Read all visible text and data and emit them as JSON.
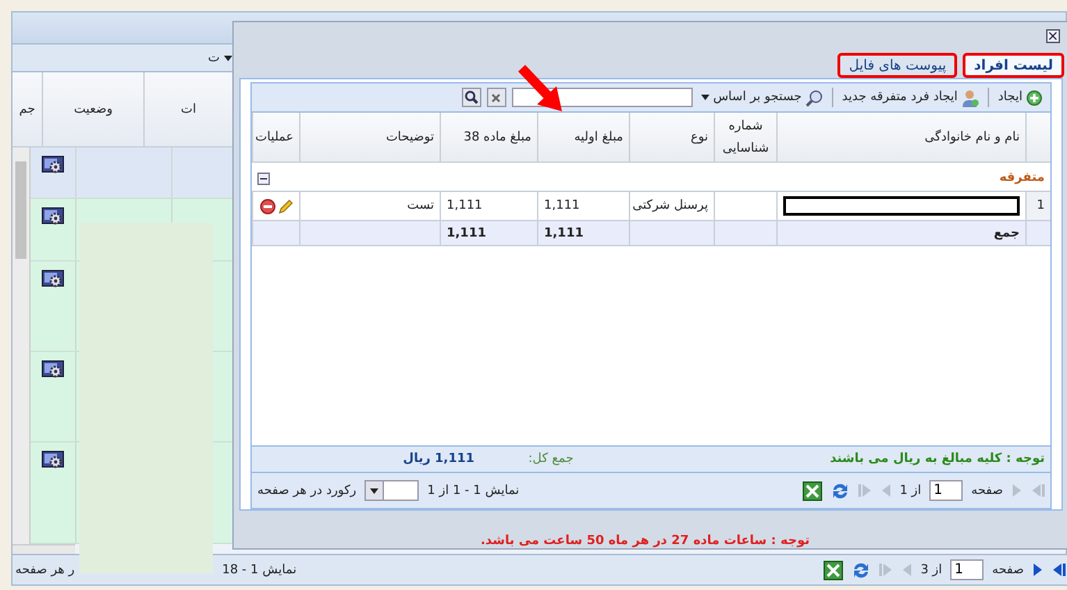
{
  "background_grid": {
    "toolbar_label": "ت",
    "columns": [
      "ات",
      "وضعیت",
      "جم"
    ],
    "rows": [
      {
        "selected": true
      },
      {
        "selected": false
      },
      {
        "selected": false
      },
      {
        "selected": false
      },
      {
        "selected": false
      }
    ],
    "pager": {
      "per_page_label": "ر هر صفحه",
      "summary": "نمایش 1 - 18",
      "page_label": "صفحه",
      "page": "1",
      "of": "از 3",
      "prev_disabled": true,
      "next_disabled": false
    }
  },
  "dialog": {
    "close": "×",
    "tabs": [
      {
        "label": "لیست افراد",
        "selected": true,
        "highlighted": true
      },
      {
        "label": "پیوست های فایل",
        "selected": false,
        "highlighted": true
      }
    ],
    "toolbar": {
      "create": "ایجاد",
      "create_person": "ایجاد فرد متفرقه جدید",
      "search_by": "جستجو بر اساس"
    },
    "columns": [
      "",
      "نام و نام خانوادگی",
      "شماره شناسایی",
      "نوع",
      "مبلغ اولیه",
      "مبلغ ماده 38",
      "توضیحات",
      "عملیات"
    ],
    "group": {
      "label": "متفرقه",
      "expanded": true
    },
    "rows": [
      {
        "index": "1",
        "type": "پرسنل شرکتی",
        "initial_amount": "1,111",
        "article38_amount": "1,111",
        "description": "تست"
      }
    ],
    "totals": {
      "label": "جمع",
      "initial_amount": "1,111",
      "article38_amount": "1,111"
    },
    "footer": {
      "note": "توجه : کلیه مبالغ به ریال می باشند",
      "total_label": "جمع کل:",
      "total_value": "1,111 ریال"
    },
    "pager": {
      "page_label": "صفحه",
      "page": "1",
      "of": "از 1",
      "summary": "نمایش 1 - 1 از 1",
      "per_page_label": "رکورد در هر صفحه",
      "prev_disabled": true,
      "next_disabled": true
    },
    "note": "توجه : ساعات ماده 27 در هر ماه 50 ساعت می باشد."
  }
}
